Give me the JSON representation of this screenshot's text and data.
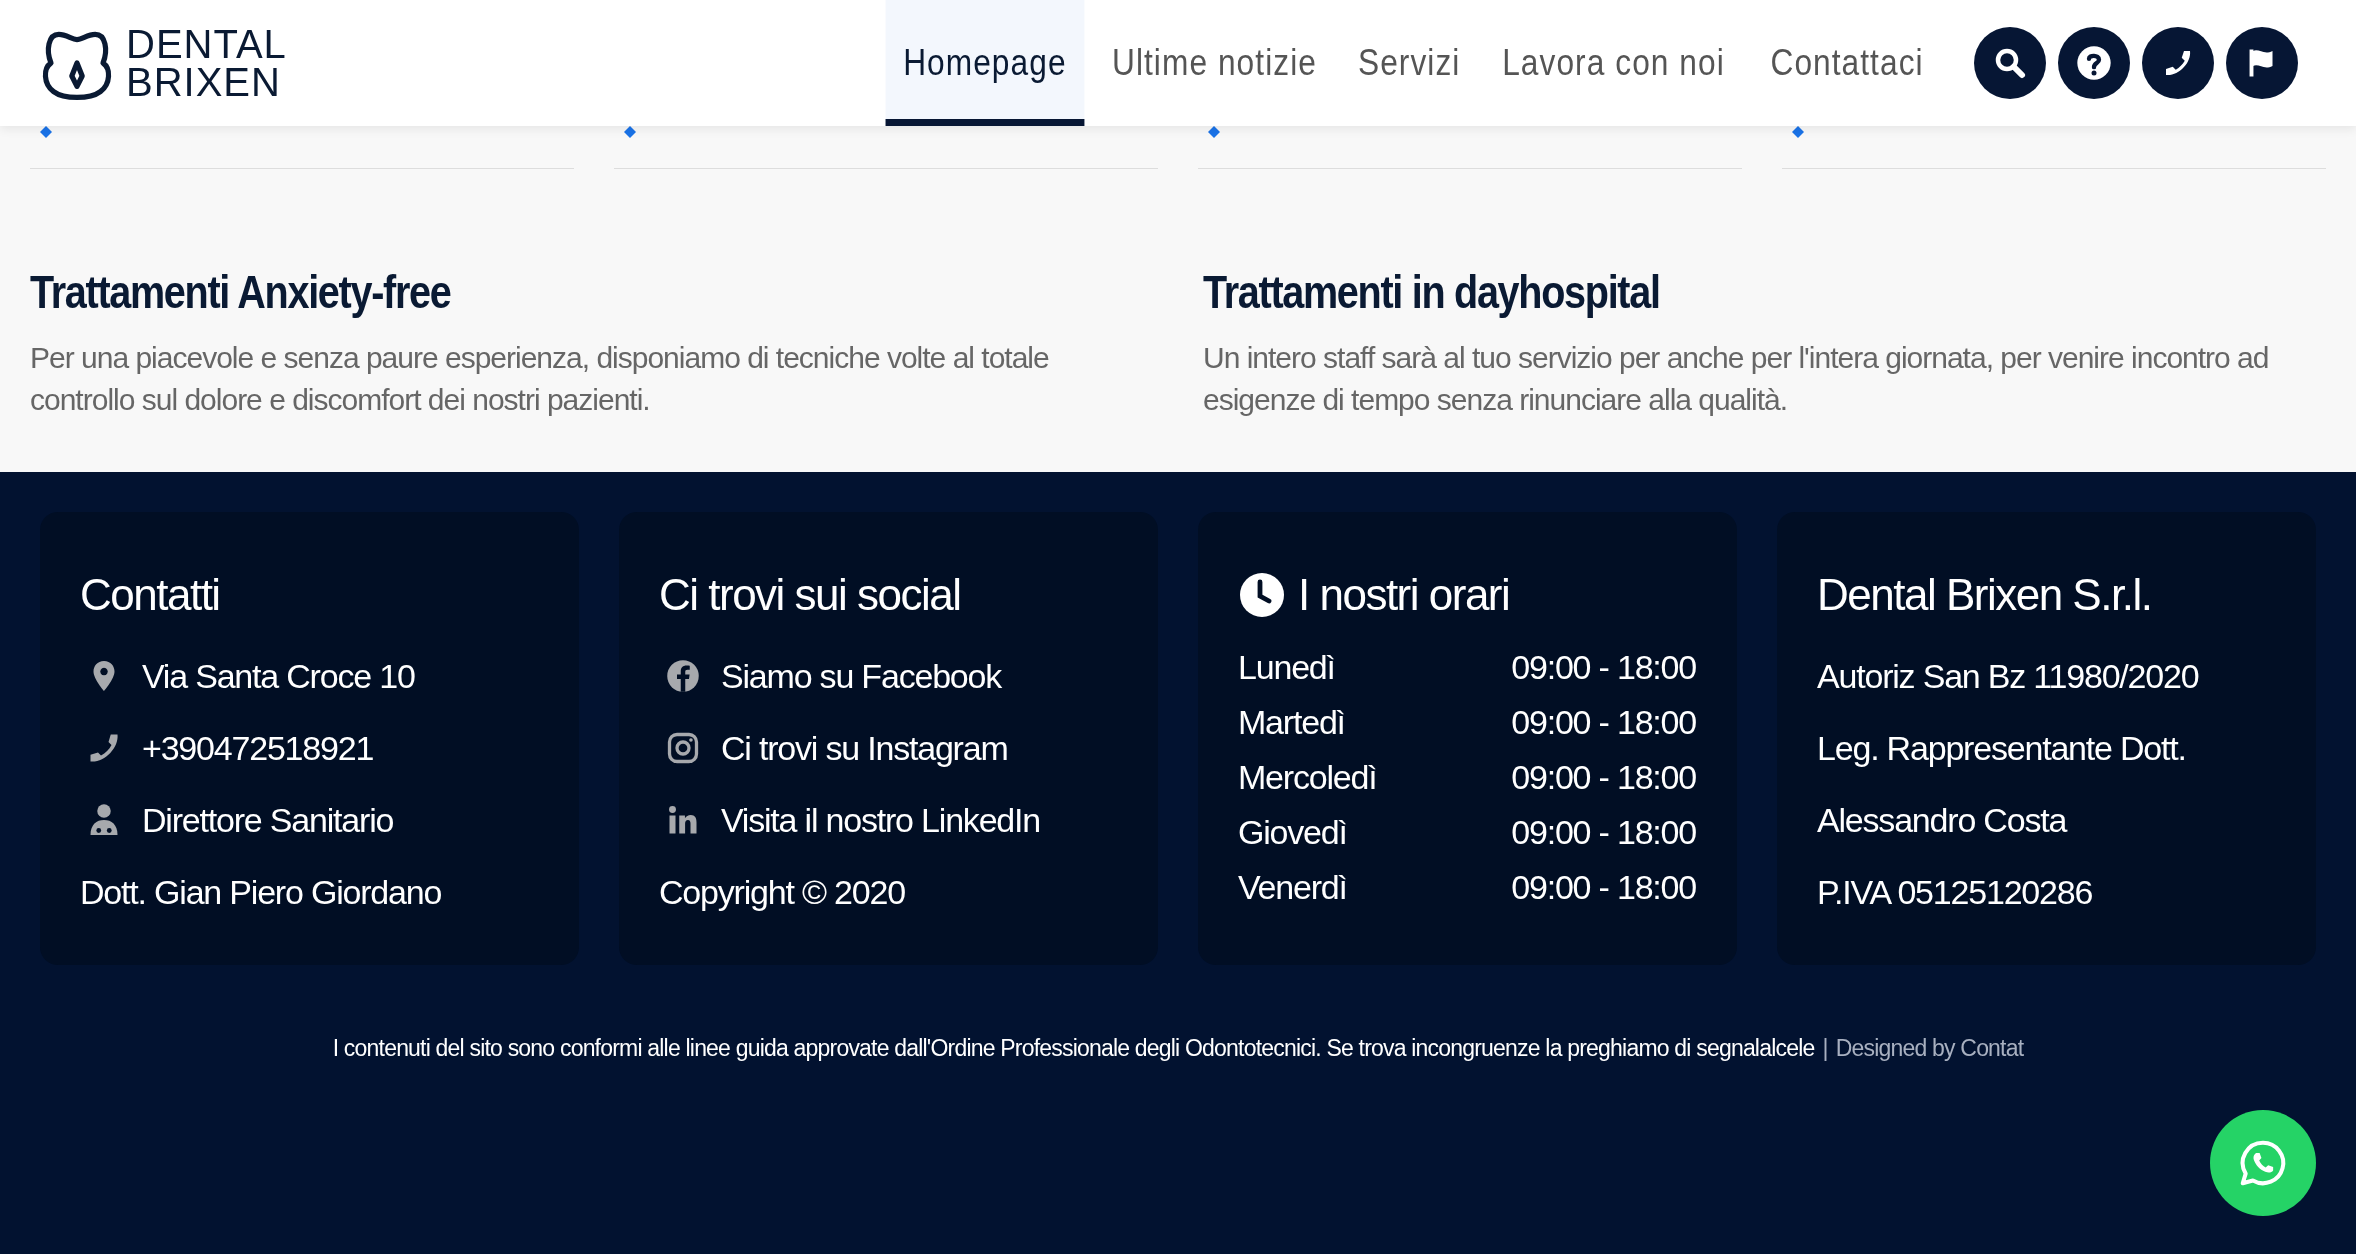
{
  "header": {
    "logo_text": [
      "DENTAL",
      "BRIXEN"
    ],
    "nav": [
      {
        "label": "Homepage",
        "selected": true
      },
      {
        "label": "Ultime notizie",
        "selected": false
      },
      {
        "label": "Servizi",
        "selected": false
      },
      {
        "label": "Lavora con noi",
        "selected": false
      },
      {
        "label": "Contattaci",
        "selected": false
      }
    ],
    "icon_buttons": [
      {
        "kind": "search"
      },
      {
        "kind": "help"
      },
      {
        "kind": "phone"
      },
      {
        "kind": "flag"
      }
    ]
  },
  "features": [
    {
      "title": "Trattamenti Anxiety-free",
      "text": "Per una piacevole e senza paure esperienza, disponiamo di tecniche volte al totale controllo sul dolore e discomfort dei nostri pazienti."
    },
    {
      "title": "Trattamenti in dayhospital",
      "text": "Un intero staff sarà al tuo servizio per anche per l'intera giornata, per venire incontro ad esigenze di tempo senza rinunciare alla qualità."
    }
  ],
  "footer": {
    "contacts": {
      "title": "Contatti",
      "items": [
        {
          "kind": "location",
          "text": "Via Santa Croce 10"
        },
        {
          "kind": "phone",
          "text": "+390472518921"
        },
        {
          "kind": "doctor",
          "text": "Direttore Sanitario"
        },
        {
          "kind": "plain",
          "text": "Dott. Gian Piero Giordano"
        }
      ]
    },
    "social": {
      "title": "Ci trovi sui social",
      "items": [
        {
          "kind": "facebook",
          "text": "Siamo su Facebook"
        },
        {
          "kind": "instagram",
          "text": "Ci trovi su Instagram"
        },
        {
          "kind": "linkedin",
          "text": "Visita il nostro LinkedIn"
        },
        {
          "kind": "plain",
          "text": "Copyright © 2020"
        }
      ]
    },
    "hours": {
      "title": "I nostri orari",
      "rows": [
        {
          "day": "Lunedì",
          "time": "09:00 - 18:00"
        },
        {
          "day": "Martedì",
          "time": "09:00 - 18:00"
        },
        {
          "day": "Mercoledì",
          "time": "09:00 - 18:00"
        },
        {
          "day": "Giovedì",
          "time": "09:00 - 18:00"
        },
        {
          "day": "Venerdì",
          "time": "09:00 - 18:00"
        }
      ]
    },
    "company": {
      "title": "Dental Brixen S.r.l.",
      "lines": [
        "Autoriz San Bz 11980/2020",
        "Leg. Rappresentante Dott.",
        "Alessandro Costa",
        "P.IVA 05125120286"
      ]
    },
    "note": "I contenuti del sito sono conformi alle linee guida approvate dall'Ordine Professionale degli Odontotecnici. Se trova incongruenze la preghiamo di segnalalcele",
    "separator": "|",
    "credit": "Designed by Contat"
  }
}
